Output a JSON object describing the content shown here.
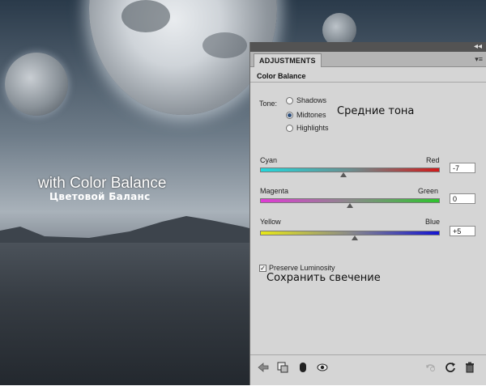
{
  "overlay": {
    "caption_en": "with Color Balance",
    "caption_ru": "Цветовой Баланс"
  },
  "panel": {
    "tab_label": "ADJUSTMENTS",
    "title": "Color Balance",
    "tone": {
      "label": "Tone:",
      "options": [
        "Shadows",
        "Midtones",
        "Highlights"
      ],
      "selected": "Midtones",
      "annotation_ru": "Средние тона"
    },
    "sliders": [
      {
        "left": "Cyan",
        "right": "Red",
        "value": "-7",
        "level": -7
      },
      {
        "left": "Magenta",
        "right": "Green",
        "value": "0",
        "level": 0
      },
      {
        "left": "Yellow",
        "right": "Blue",
        "value": "+5",
        "level": 5
      }
    ],
    "preserve": {
      "label": "Preserve Luminosity",
      "checked": true,
      "annotation_ru": "Сохранить свечение"
    },
    "bottom_icons": [
      "back-arrow-icon",
      "clip-to-layer-icon",
      "mask-icon",
      "visibility-eye-icon",
      "previous-state-icon",
      "reset-icon",
      "trash-icon"
    ],
    "colors": {
      "panel_bg": "#d5d5d5",
      "topbar_bg": "#535353",
      "cyan": "#22d8dc",
      "red": "#d11a1a",
      "magenta": "#e13ad6",
      "green": "#2ec42e",
      "yellow": "#e8e817",
      "blue": "#1414d2"
    }
  }
}
